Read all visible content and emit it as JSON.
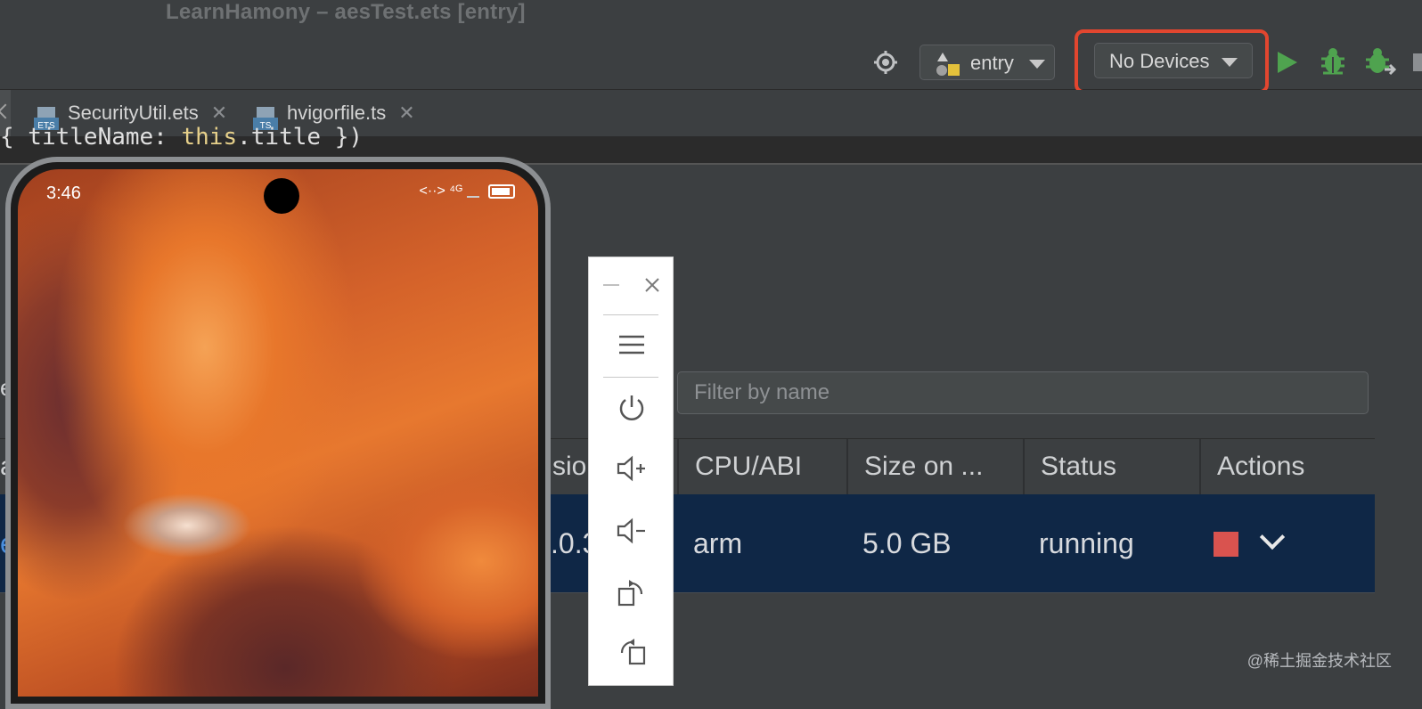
{
  "window": {
    "title": "LearnHamony – aesTest.ets [entry]"
  },
  "toolbar": {
    "module_select": "entry",
    "device_select": "No Devices"
  },
  "tabs": [
    {
      "label": "SecurityUtil.ets",
      "type": "ETS"
    },
    {
      "label": "hvigorfile.ts",
      "type": "TS"
    }
  ],
  "code": {
    "text_pre": "{ titleName: ",
    "keyword": "this",
    "text_post": ".title })"
  },
  "phone": {
    "time": "3:46",
    "network": "<··> ⁴ᴳ"
  },
  "filter": {
    "placeholder": "Filter by name"
  },
  "table": {
    "columns": [
      "sion",
      "CPU/ABI",
      "Size on ...",
      "Status",
      "Actions"
    ],
    "first_col_stub": "a",
    "row": {
      "stub": "e",
      "version": ".0.3",
      "cpu": "arm",
      "size": "5.0 GB",
      "status": "running"
    }
  },
  "left_edge": {
    "mark": "e"
  },
  "watermark": "@稀土掘金技术社区",
  "colors": {
    "highlight": "#e2462f",
    "run": "#4fa34f",
    "selected_row": "#0f2746",
    "stop": "#d9534f"
  }
}
